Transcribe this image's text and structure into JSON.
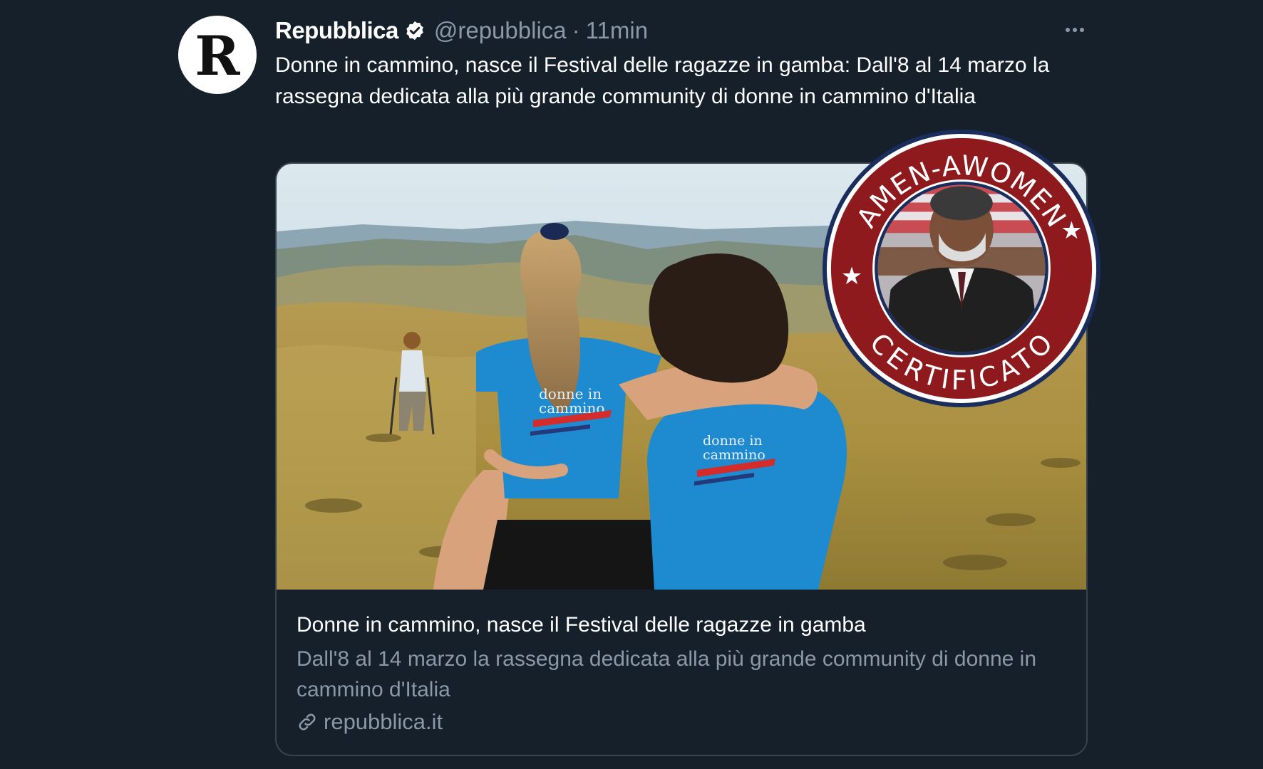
{
  "tweet": {
    "author": {
      "avatar_letter": "R",
      "display_name": "Repubblica",
      "handle": "@repubblica",
      "separator": "·",
      "time": "11min",
      "verified_icon": "verified-badge-icon"
    },
    "more_icon": "more-dots-icon",
    "text": "Donne in cammino, nasce il Festival delle ragazze in gamba: Dall'8 al 14 marzo la rassegna dedicata alla più grande community di donne in cammino d'Italia",
    "card": {
      "image_alt": "Due donne abbracciate in maglia blu 'donne in cammino' guardano le colline",
      "shirt_text_1": "donne in cammino",
      "shirt_text_2": "donne in cammino",
      "title": "Donne in cammino, nasce il Festival delle ragazze in gamba",
      "description": "Dall'8 al 14 marzo la rassegna dedicata alla più grande community di donne in cammino d'Italia",
      "domain": "repubblica.it",
      "link_icon": "link-icon"
    }
  },
  "stamp": {
    "top_text": "AMEN-AWOMEN",
    "bottom_text": "CERTIFICATO",
    "color": "#8e1a1e"
  },
  "theme": {
    "background": "#15202b",
    "text_primary": "#ffffff",
    "text_secondary": "#8b98a5",
    "border": "#38444d",
    "shirt_blue": "#1e8ad0"
  }
}
